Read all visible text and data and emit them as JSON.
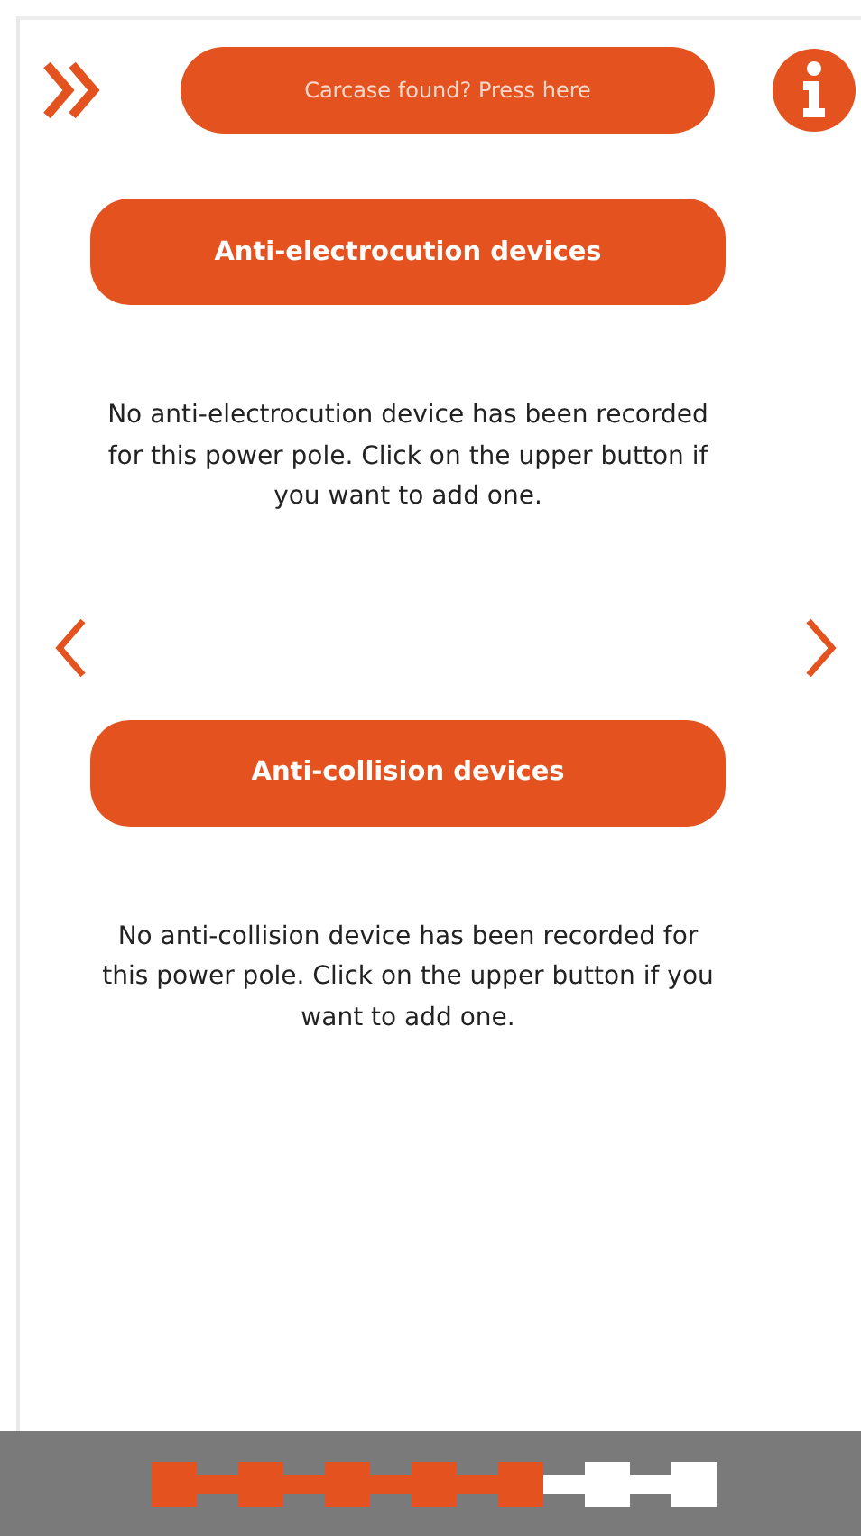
{
  "header": {
    "report_button": "Carcase found? Press here"
  },
  "sections": [
    {
      "button": "Anti-electrocution devices",
      "message": "No anti-electrocution device has been recorded for this power pole. Click on the upper button if you want to add one."
    },
    {
      "button": "Anti-collision devices",
      "message": "No anti-collision device has been recorded for this power pole. Click on the upper button if you want to add one."
    }
  ],
  "progress": {
    "steps": [
      {
        "done": true
      },
      {
        "done": true
      },
      {
        "done": true
      },
      {
        "done": true
      },
      {
        "done": true
      },
      {
        "done": false
      },
      {
        "done": false
      }
    ]
  }
}
